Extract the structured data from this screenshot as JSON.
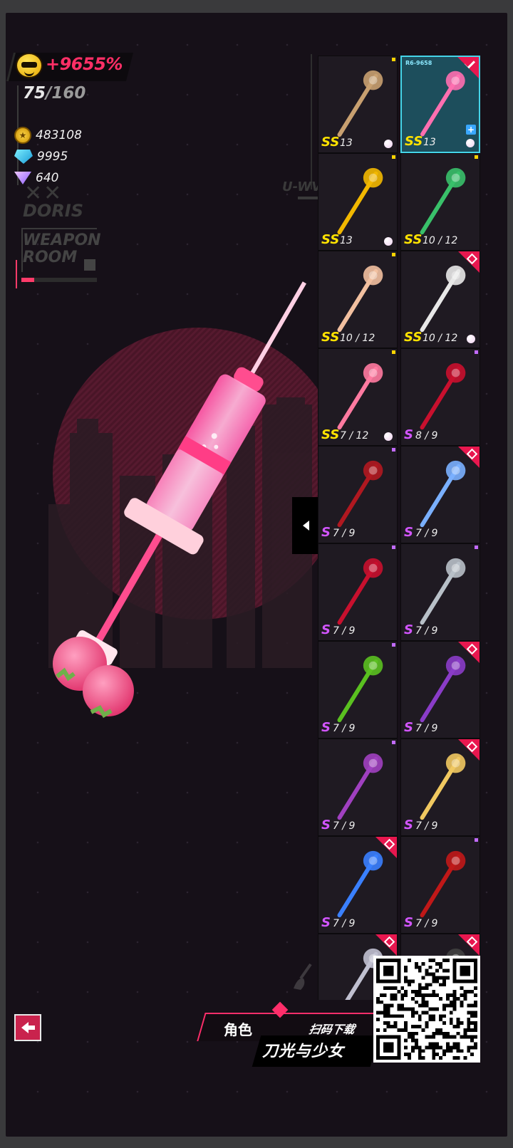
{
  "hud": {
    "score": "+9655%",
    "capacity_current": "75",
    "capacity_sep": "/",
    "capacity_max": "160",
    "gold": "483108",
    "diamonds": "9995",
    "crystals": "640"
  },
  "decor": {
    "xx": "✕✕",
    "doris": "DORIS",
    "weapon_room_line1": "WEAPON",
    "weapon_room_line2": "ROOM",
    "uwv": "U-WV"
  },
  "colors": {
    "accent": "#ff2e6a",
    "rank_ss": "#ffe200",
    "rank_s": "#d255ff",
    "selected": "#45d4e8"
  },
  "weapons": [
    {
      "name": "card-weapon",
      "rank": "SS",
      "level": "13",
      "marker": "dot-y",
      "pearl": true,
      "icon": "playing-card-icon"
    },
    {
      "name": "syringe-weapon",
      "rank": "SS",
      "level": "13",
      "selected": true,
      "code": "R6-9658",
      "check": true,
      "pearl": true,
      "plus": true,
      "icon": "syringe-icon"
    },
    {
      "name": "bell-weapon",
      "rank": "SS",
      "level": "13",
      "marker": "dot-y",
      "pearl": true,
      "icon": "bell-icon"
    },
    {
      "name": "vine-sword-weapon",
      "rank": "SS",
      "level": "10 / 12",
      "marker": "dot-y",
      "icon": "vine-sword-icon"
    },
    {
      "name": "doll-club-weapon",
      "rank": "SS",
      "level": "10 / 12",
      "marker": "dot-y",
      "icon": "doll-club-icon"
    },
    {
      "name": "axe-weapon",
      "rank": "SS",
      "level": "10 / 12",
      "tag": true,
      "pearl": true,
      "icon": "axe-icon"
    },
    {
      "name": "plunger-weapon",
      "rank": "SS",
      "level": "7 / 12",
      "marker": "dot-y",
      "pearl": true,
      "icon": "plunger-icon"
    },
    {
      "name": "scythe-weapon",
      "rank": "S",
      "level": "8 / 9",
      "marker": "dot-p",
      "icon": "scythe-icon"
    },
    {
      "name": "spiked-mace-weapon",
      "rank": "S",
      "level": "7 / 9",
      "marker": "dot-p",
      "icon": "spiked-mace-icon"
    },
    {
      "name": "phone-staff-weapon",
      "rank": "S",
      "level": "7 / 9",
      "tag": true,
      "icon": "phone-staff-icon"
    },
    {
      "name": "red-staff-weapon",
      "rank": "S",
      "level": "7 / 9",
      "marker": "dot-p",
      "icon": "red-staff-icon"
    },
    {
      "name": "skull-scepter-weapon",
      "rank": "S",
      "level": "7 / 9",
      "marker": "dot-p",
      "icon": "skull-scepter-icon"
    },
    {
      "name": "green-wand-weapon",
      "rank": "S",
      "level": "7 / 9",
      "marker": "dot-p",
      "icon": "green-wand-icon"
    },
    {
      "name": "purple-eye-weapon",
      "rank": "S",
      "level": "7 / 9",
      "tag": true,
      "icon": "purple-eye-icon"
    },
    {
      "name": "heart-eye-wand-weapon",
      "rank": "S",
      "level": "7 / 9",
      "marker": "dot-p",
      "icon": "heart-eye-wand-icon"
    },
    {
      "name": "unicorn-staff-weapon",
      "rank": "S",
      "level": "7 / 9",
      "tag": true,
      "icon": "unicorn-staff-icon"
    },
    {
      "name": "eye-spear-weapon",
      "rank": "S",
      "level": "7 / 9",
      "tag": true,
      "icon": "eye-spear-icon"
    },
    {
      "name": "red-greatsword-weapon",
      "rank": "S",
      "level": "7 / 9",
      "marker": "dot-p",
      "icon": "red-greatsword-icon"
    },
    {
      "name": "bone-staff-weapon",
      "rank": "",
      "level": "",
      "tag": true,
      "icon": "bone-staff-icon"
    },
    {
      "name": "dark-weapon",
      "rank": "",
      "level": "",
      "tag": true,
      "icon": "dark-weapon-icon"
    }
  ],
  "bottom": {
    "tab_label": "角色",
    "scan_text": "扫码下载",
    "game_name": "刀光与少女"
  }
}
